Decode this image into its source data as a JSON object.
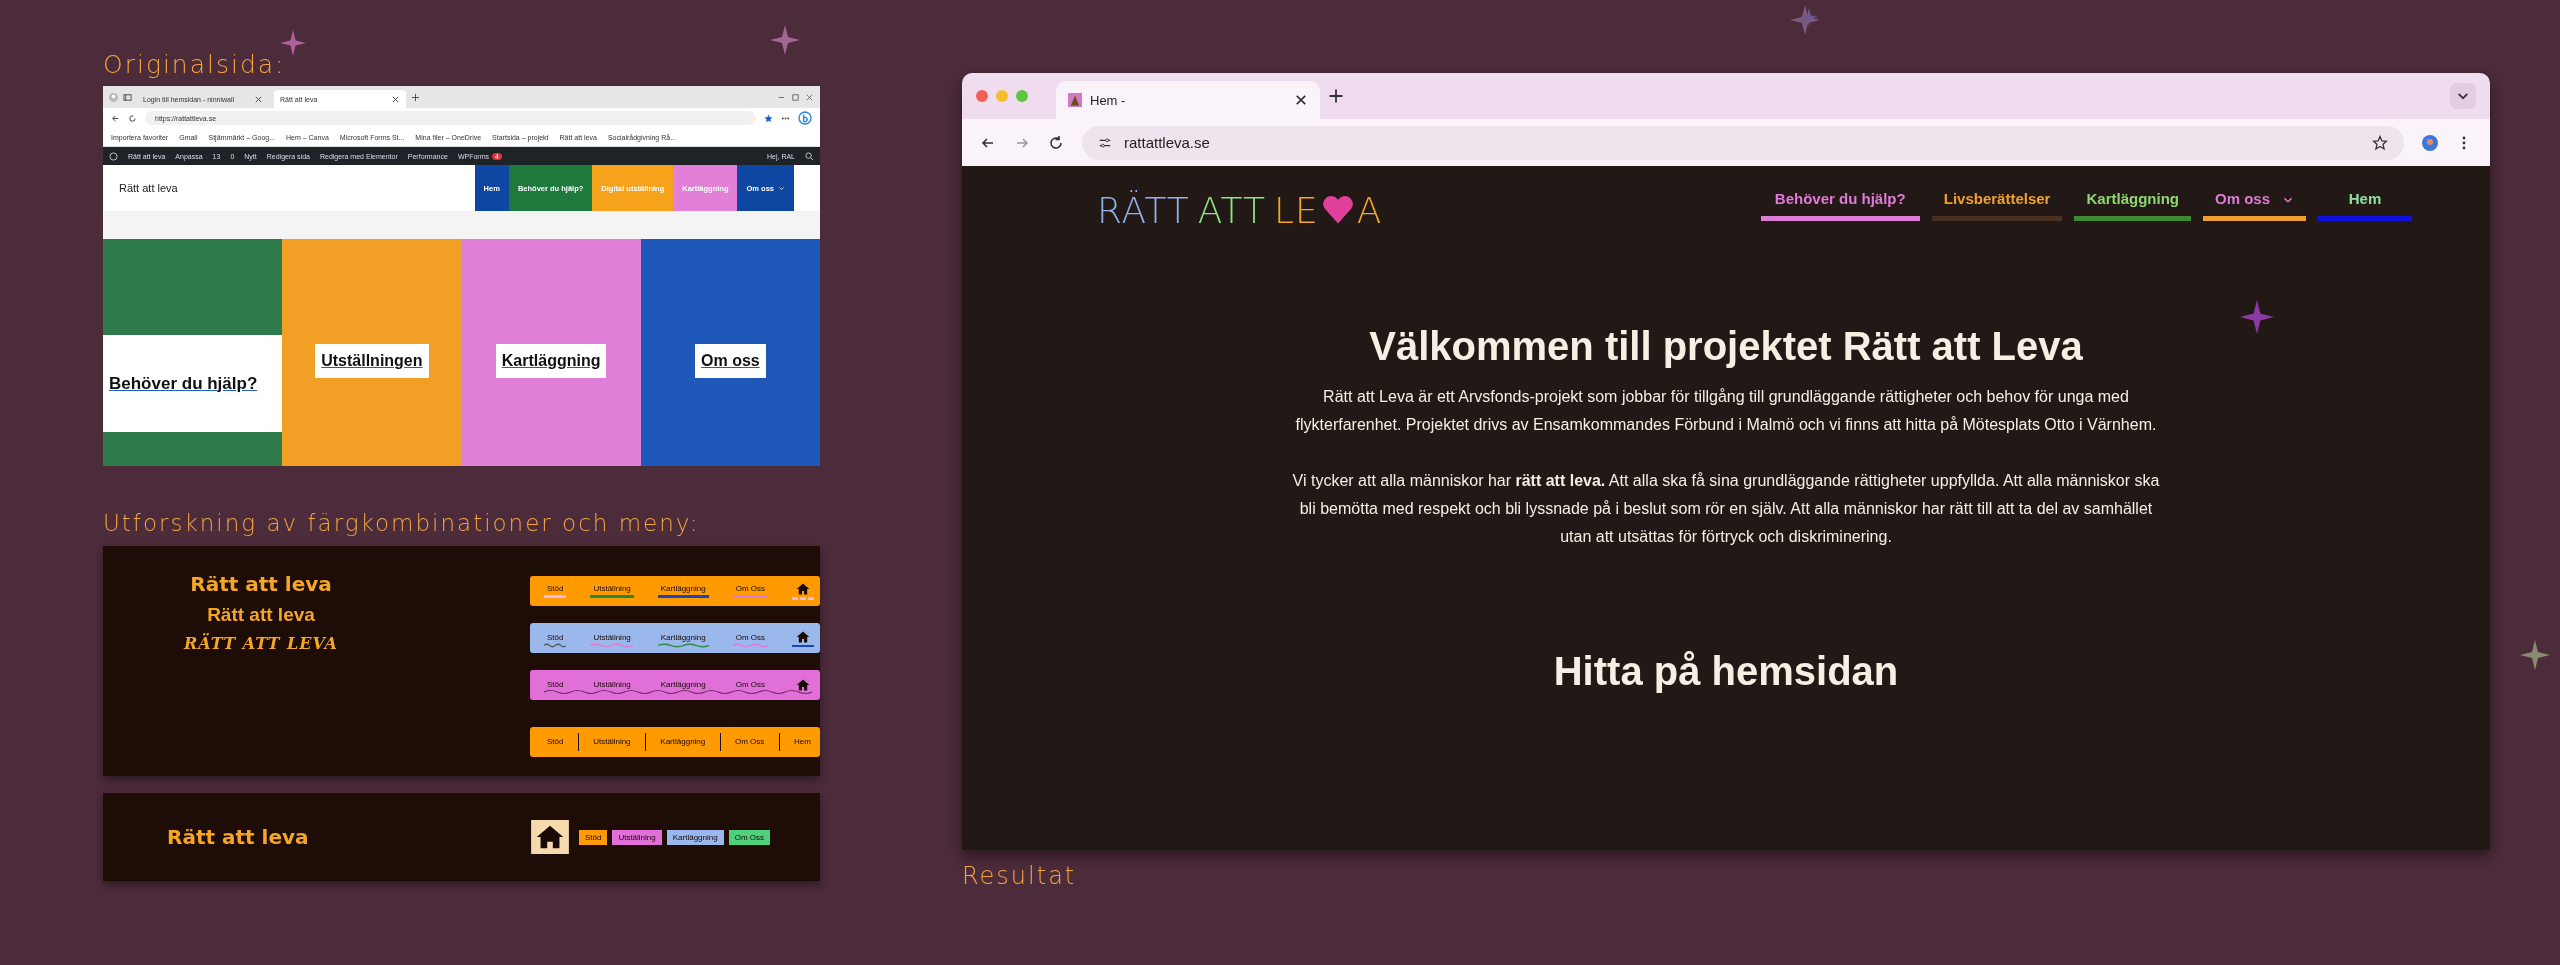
{
  "original": {
    "heading": "Originalsida:",
    "browser": {
      "tabs": [
        {
          "label": "Login till hemsidan - ninniwall",
          "selected": false
        },
        {
          "label": "Rätt att leva",
          "selected": true
        }
      ],
      "url": "https://rattattleva.se",
      "bookmarks": [
        "Importera favoriter",
        "Gmail",
        "Stjärnmärkt – Goog...",
        "Hem – Canva",
        "Microsoft Forms St...",
        "Mina filer – OneDrive",
        "Startsida – projekt",
        "Rätt att leva",
        "Socialrådgivning Rå..."
      ],
      "admin_bar": {
        "items": [
          "Rätt att leva",
          "Anpassa",
          "13",
          "0",
          "Nytt",
          "Redigera sida",
          "Redigera med Elementor",
          "Performance",
          "WPForms"
        ],
        "badge": "4",
        "greeting": "Hej, RAL"
      },
      "site_title": "Rätt att leva",
      "nav": [
        {
          "label": "Hem",
          "color": "#0d47a1",
          "dropdown": false
        },
        {
          "label": "Behöver du hjälp?",
          "color": "#1e7a3c",
          "dropdown": false
        },
        {
          "label": "Digital utställning",
          "color": "#f7a21b",
          "dropdown": false
        },
        {
          "label": "Kartläggning",
          "color": "#e27fd6",
          "dropdown": false
        },
        {
          "label": "Om oss",
          "color": "#0d47a1",
          "dropdown": true
        }
      ],
      "tiles": [
        {
          "label": "Behöver du hjälp?",
          "color": "#2f7a4b",
          "wide": true
        },
        {
          "label": "Utställningen",
          "color": "#f2a025",
          "wide": false
        },
        {
          "label": "Kartläggning",
          "color": "#e07fd8",
          "wide": false
        },
        {
          "label": "Om oss",
          "color": "#1f58b8",
          "wide": false
        }
      ]
    }
  },
  "exploration": {
    "heading": "Utforskning av färgkombinationer och meny:",
    "titles": [
      {
        "text": "Rätt att leva",
        "kind": "heavy"
      },
      {
        "text": "Rätt att leva",
        "kind": "sans"
      },
      {
        "text": "RÄTT ATT LEVA",
        "kind": "script"
      }
    ],
    "menus": [
      {
        "kind": "underline",
        "color": "#ff9a00",
        "items": [
          {
            "kind": "text",
            "label": "Stöd",
            "color": "#f3b6e8"
          },
          {
            "kind": "text",
            "label": "Utställning",
            "color": "#1e8a3c"
          },
          {
            "kind": "text",
            "label": "Kartläggning",
            "color": "#1448b8"
          },
          {
            "kind": "text",
            "label": "Om Oss",
            "color": "#e07ad8"
          },
          {
            "kind": "home",
            "color": "#f3b6e8"
          }
        ]
      },
      {
        "kind": "wavy",
        "color": "#9ab8ec",
        "items": [
          {
            "kind": "text",
            "label": "Stöd",
            "color": "#555555"
          },
          {
            "kind": "text",
            "label": "Utställning",
            "color": "#e07ad8"
          },
          {
            "kind": "text",
            "label": "Kartläggning",
            "color": "#2e8a4a"
          },
          {
            "kind": "text",
            "label": "Om Oss",
            "color": "#e07ad8"
          },
          {
            "kind": "home",
            "color": "#1448b8"
          }
        ]
      },
      {
        "kind": "waveline",
        "color": "#e070d8",
        "items": [
          {
            "kind": "text",
            "label": "Stöd"
          },
          {
            "kind": "text",
            "label": "Utställning"
          },
          {
            "kind": "text",
            "label": "Kartläggning"
          },
          {
            "kind": "text",
            "label": "Om Oss"
          },
          {
            "kind": "home"
          }
        ]
      },
      {
        "kind": "dividers",
        "color": "#ff9a00",
        "items": [
          {
            "kind": "text",
            "label": "Stöd"
          },
          {
            "kind": "text",
            "label": "Utställning"
          },
          {
            "kind": "text",
            "label": "Kartläggning"
          },
          {
            "kind": "text",
            "label": "Om Oss"
          },
          {
            "kind": "text",
            "label": "Hem"
          }
        ]
      }
    ],
    "alt": {
      "title": "Rätt att leva",
      "buttons": [
        {
          "label": "Stöd",
          "color": "#ff9a00"
        },
        {
          "label": "Utställning",
          "color": "#e070d8"
        },
        {
          "label": "Kartläggning",
          "color": "#9ab8ec"
        },
        {
          "label": "Om Oss",
          "color": "#4fd07a"
        }
      ]
    }
  },
  "result": {
    "browser": {
      "tab": "Hem -",
      "url": "rattattleva.se"
    },
    "logo": [
      {
        "kind": "text",
        "text": "RÄTT",
        "color": "#8fb0e8"
      },
      {
        "kind": "text",
        "text": "ATT",
        "color": "#8fe08a"
      },
      {
        "kind": "text",
        "text": "LE",
        "color": "#f5a623"
      },
      {
        "kind": "heart",
        "color": "#e0409a"
      },
      {
        "kind": "text",
        "text": "A",
        "color": "#f5a623"
      }
    ],
    "nav": [
      {
        "label": "Behöver du hjälp?",
        "color": "#e07ad8",
        "underline": {
          "color": "#e07ad8"
        },
        "dropdown": false
      },
      {
        "label": "Livsberättelser",
        "color": "#f0a030",
        "underline": {
          "color": "#4a3020"
        },
        "dropdown": false
      },
      {
        "label": "Kartläggning",
        "color": "#8ed870",
        "underline": {
          "color": "#3e8a30"
        },
        "dropdown": false
      },
      {
        "label": "Om oss",
        "color": "#e07ad8",
        "underline": {
          "color": "#f0a030"
        },
        "dropdown": true
      },
      {
        "label": "Hem",
        "color": "#8ee0a0",
        "underline": {
          "color": "#1010e0"
        },
        "dropdown": false
      }
    ],
    "heading": "Välkommen till projektet Rätt att Leva",
    "paragraphs": [
      "Rätt att Leva är ett Arvsfonds-projekt som jobbar för tillgång till grundläggande rättigheter och behov för unga med flykterfarenhet. Projektet drivs av Ensamkommandes Förbund i Malmö och vi finns att hitta på Mötesplats Otto i Värnhem.",
      "Vi tycker att alla människor har **rätt att leva.** Att alla ska få sina grundläggande rättigheter uppfyllda. Att alla människor ska bli bemötta med respekt och bli lyssnade på i beslut som rör en själv. Att alla människor har rätt till att ta del av samhället utan att utsättas för förtryck och diskriminering."
    ],
    "subheading": "Hitta på hemsidan",
    "caption": "Resultat"
  }
}
